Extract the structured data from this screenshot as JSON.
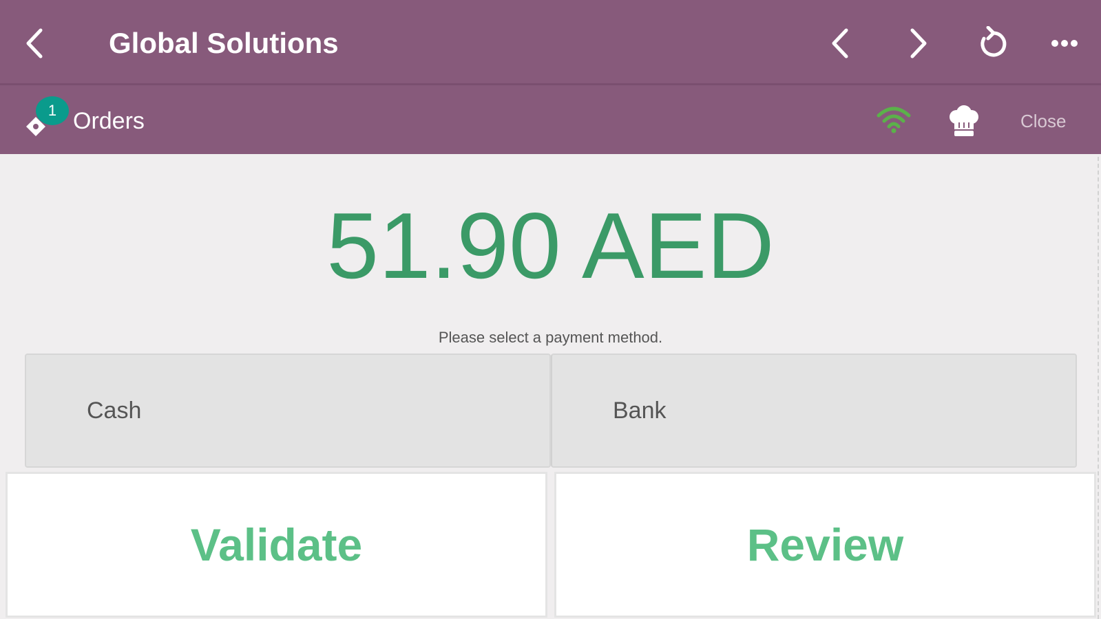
{
  "header": {
    "title": "Global Solutions",
    "back_icon": "chevron-left-icon",
    "nav": {
      "prev_icon": "chevron-left-icon",
      "next_icon": "chevron-right-icon",
      "reload_icon": "reload-icon",
      "more_icon": "more-horizontal-icon"
    },
    "background_color": "#875a7b"
  },
  "subheader": {
    "orders_badge": "1",
    "orders_label": "Orders",
    "orders_icon": "ticket-icon",
    "wifi_icon": "wifi-icon",
    "wifi_color": "#5bb14a",
    "chef_icon": "chef-hat-icon",
    "close_label": "Close"
  },
  "payment": {
    "amount": "51.90 AED",
    "hint": "Please select a payment method.",
    "methods": [
      {
        "label": "Cash"
      },
      {
        "label": "Bank"
      }
    ],
    "amount_color": "#3b9a67"
  },
  "actions": {
    "validate_label": "Validate",
    "review_label": "Review",
    "color": "#5cc087"
  }
}
